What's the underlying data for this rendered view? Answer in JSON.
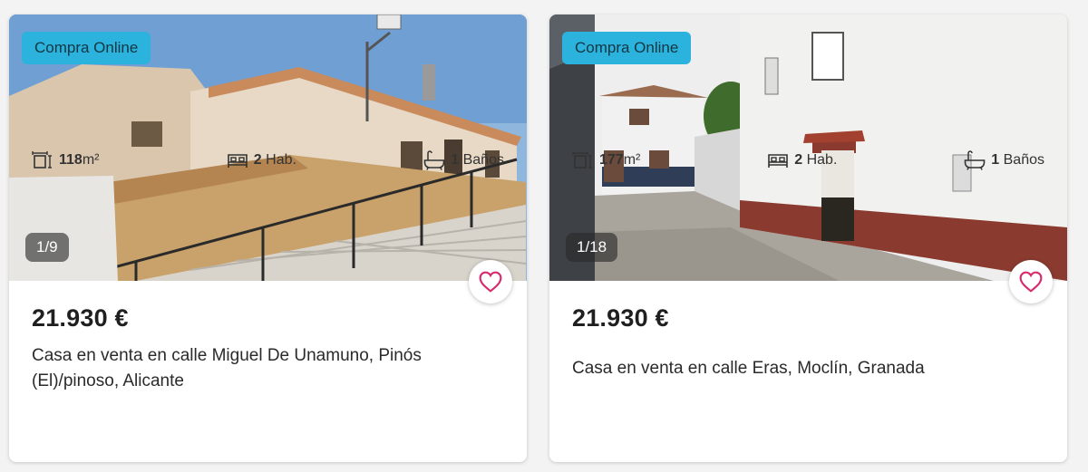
{
  "listings": [
    {
      "badge": "Compra Online",
      "photo_counter": "1/9",
      "price": "21.930 €",
      "title": "Casa en venta en calle Miguel De Unamuno, Pinós (El)/pinoso, Alicante",
      "area_value": "118",
      "area_unit": "m²",
      "rooms_value": "2",
      "rooms_unit": "Hab.",
      "baths_value": "1",
      "baths_unit": "Baños",
      "icons": [
        "heart-icon",
        "area-icon",
        "bed-icon",
        "bathtub-icon"
      ]
    },
    {
      "badge": "Compra Online",
      "photo_counter": "1/18",
      "price": "21.930 €",
      "title": "Casa en venta en calle Eras, Moclín, Granada",
      "area_value": "177",
      "area_unit": "m²",
      "rooms_value": "2",
      "rooms_unit": "Hab.",
      "baths_value": "1",
      "baths_unit": "Baños",
      "icons": [
        "heart-icon",
        "area-icon",
        "bed-icon",
        "bathtub-icon"
      ]
    }
  ],
  "colors": {
    "badge_bg": "#2bb3de",
    "heart": "#d62d6f",
    "price_text": "#1f1f1f"
  }
}
